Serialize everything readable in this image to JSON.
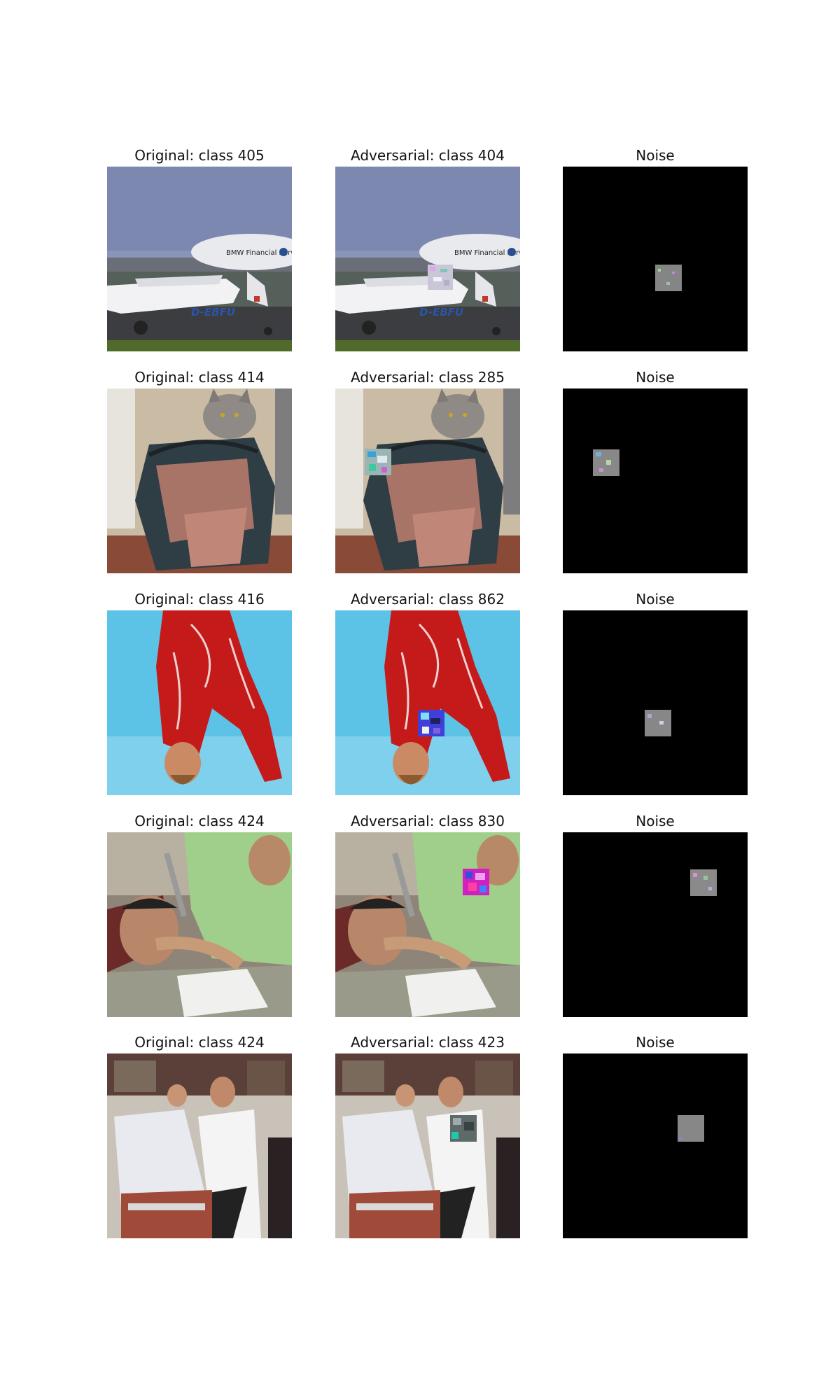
{
  "figure": {
    "rows": [
      {
        "original_title": "Original: class 405",
        "adversarial_title": "Adversarial: class 404",
        "noise_title": "Noise",
        "scene": "airship-airfield",
        "airship_text": "BMW Financial Services",
        "plane_text": "D-EBFU"
      },
      {
        "original_title": "Original: class 414",
        "adversarial_title": "Adversarial: class 285",
        "noise_title": "Noise",
        "scene": "cat-on-backpack"
      },
      {
        "original_title": "Original: class 416",
        "adversarial_title": "Adversarial: class 862",
        "noise_title": "Noise",
        "scene": "gymnast-red-leotard"
      },
      {
        "original_title": "Original: class 424",
        "adversarial_title": "Adversarial: class 830",
        "noise_title": "Noise",
        "scene": "barber-shave"
      },
      {
        "original_title": "Original: class 424",
        "adversarial_title": "Adversarial: class 423",
        "noise_title": "Noise",
        "scene": "barbershop-interior"
      }
    ]
  }
}
